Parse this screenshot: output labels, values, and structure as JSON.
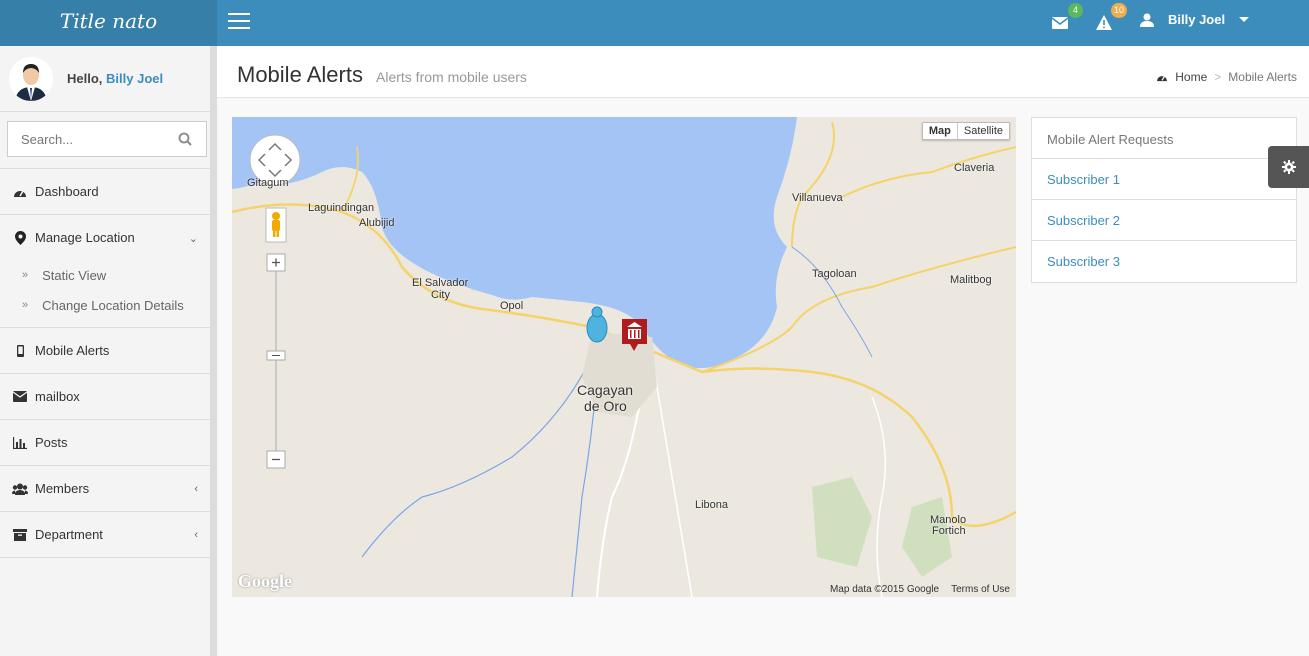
{
  "brand": {
    "title": "Title nato"
  },
  "navbar": {
    "mail_count": "4",
    "alert_count": "10",
    "user_name": "Billy Joel",
    "colors": {
      "bar": "#3c8dbc",
      "brand": "#367fa9"
    }
  },
  "sidebar": {
    "greeting": "Hello,",
    "user_name": "Billy Joel",
    "search_placeholder": "Search...",
    "items": [
      {
        "label": "Dashboard",
        "icon": "dashboard-icon"
      },
      {
        "label": "Manage Location",
        "icon": "map-marker-icon"
      },
      {
        "label": "Mobile Alerts",
        "icon": "mobile-icon"
      },
      {
        "label": "mailbox",
        "icon": "envelope-icon"
      },
      {
        "label": "Posts",
        "icon": "bar-chart-icon"
      },
      {
        "label": "Members",
        "icon": "users-icon"
      },
      {
        "label": "Department",
        "icon": "archive-icon"
      }
    ],
    "subitems": [
      {
        "label": "Static View"
      },
      {
        "label": "Change Location Details"
      }
    ]
  },
  "header": {
    "title": "Mobile Alerts",
    "subtitle": "Alerts from mobile users",
    "breadcrumb_home": "Home",
    "breadcrumb_current": "Mobile Alerts"
  },
  "map": {
    "type_map": "Map",
    "type_satellite": "Satellite",
    "data_text": "Map data ©2015 Google",
    "terms": "Terms of Use",
    "logo": "Google",
    "labels": {
      "gitagum": "Gitagum",
      "laguindingan": "Laguindingan",
      "alubijid": "Alubijid",
      "el_salvador": "El Salvador",
      "city": "City",
      "opol": "Opol",
      "cagayan": "Cagayan",
      "de_oro": "de Oro",
      "villanueva": "Villanueva",
      "claveria": "Claveria",
      "tagoloan": "Tagoloan",
      "malitbog": "Malitbog",
      "libona": "Libona",
      "manolo": "Manolo",
      "fortich": "Fortich"
    },
    "colors": {
      "water": "#a4c4f5",
      "land": "#ece8df",
      "road": "#f5d36a"
    }
  },
  "panel": {
    "heading": "Mobile Alert Requests",
    "items": [
      "Subscriber 1",
      "Subscriber 2",
      "Subscriber 3"
    ]
  }
}
